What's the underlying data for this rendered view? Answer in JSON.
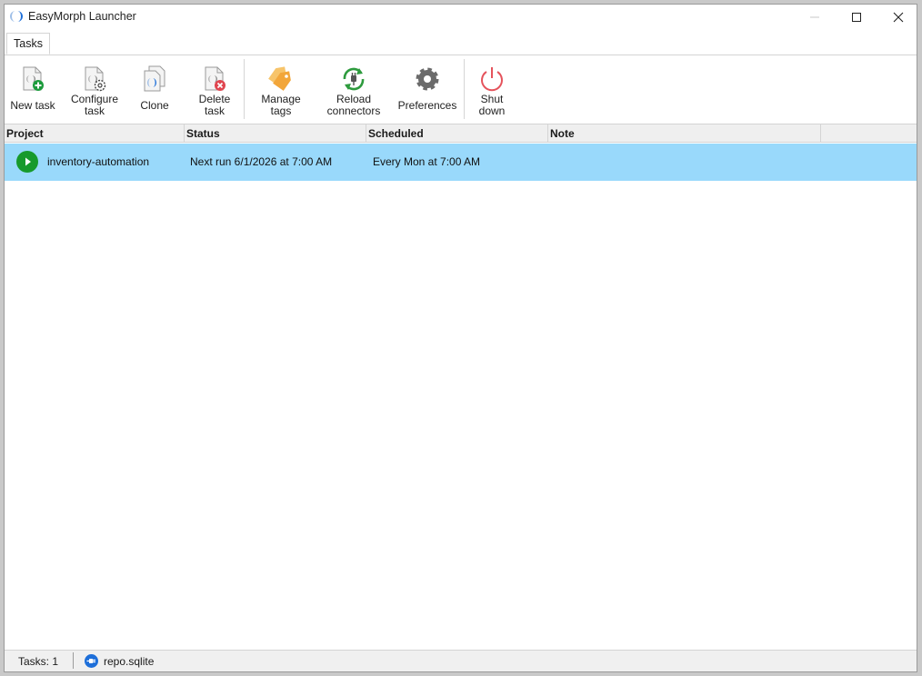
{
  "window": {
    "title": "EasyMorph Launcher"
  },
  "ribbon": {
    "tabs": [
      {
        "label": "Tasks"
      }
    ]
  },
  "toolbar": {
    "new_task": "New task",
    "configure_task": "Configure\ntask",
    "clone": "Clone",
    "delete_task": "Delete\ntask",
    "manage_tags": "Manage\ntags",
    "reload_connectors": "Reload\nconnectors",
    "preferences": "Preferences",
    "shut_down": "Shut\ndown"
  },
  "table": {
    "columns": [
      "Project",
      "Status",
      "Scheduled",
      "Note"
    ],
    "rows": [
      {
        "project": "inventory-automation",
        "status": "Next run 6/1/2026 at 7:00 AM",
        "scheduled": "Every Mon at 7:00 AM",
        "note": ""
      }
    ]
  },
  "statusbar": {
    "tasks_count": "Tasks: 1",
    "repository": "repo.sqlite"
  },
  "colors": {
    "selected_row": "#99d9fb",
    "accent_blue": "#1e6fd9",
    "add_green": "#1c9b3c",
    "delete_red": "#e0454f",
    "tag_orange": "#f2a63a",
    "reload_green": "#2e9b3e",
    "gear_gray": "#6b6b6b",
    "power_red": "#e5535c"
  },
  "icons": {
    "app": "easymorph-logo-icon",
    "new_task": "document-add-icon",
    "configure_task": "document-gear-icon",
    "clone": "documents-copy-icon",
    "delete_task": "document-delete-icon",
    "manage_tags": "tags-icon",
    "reload_connectors": "plug-reload-icon",
    "preferences": "gear-icon",
    "shut_down": "power-icon",
    "run": "play-icon",
    "repository": "database-plug-icon"
  }
}
